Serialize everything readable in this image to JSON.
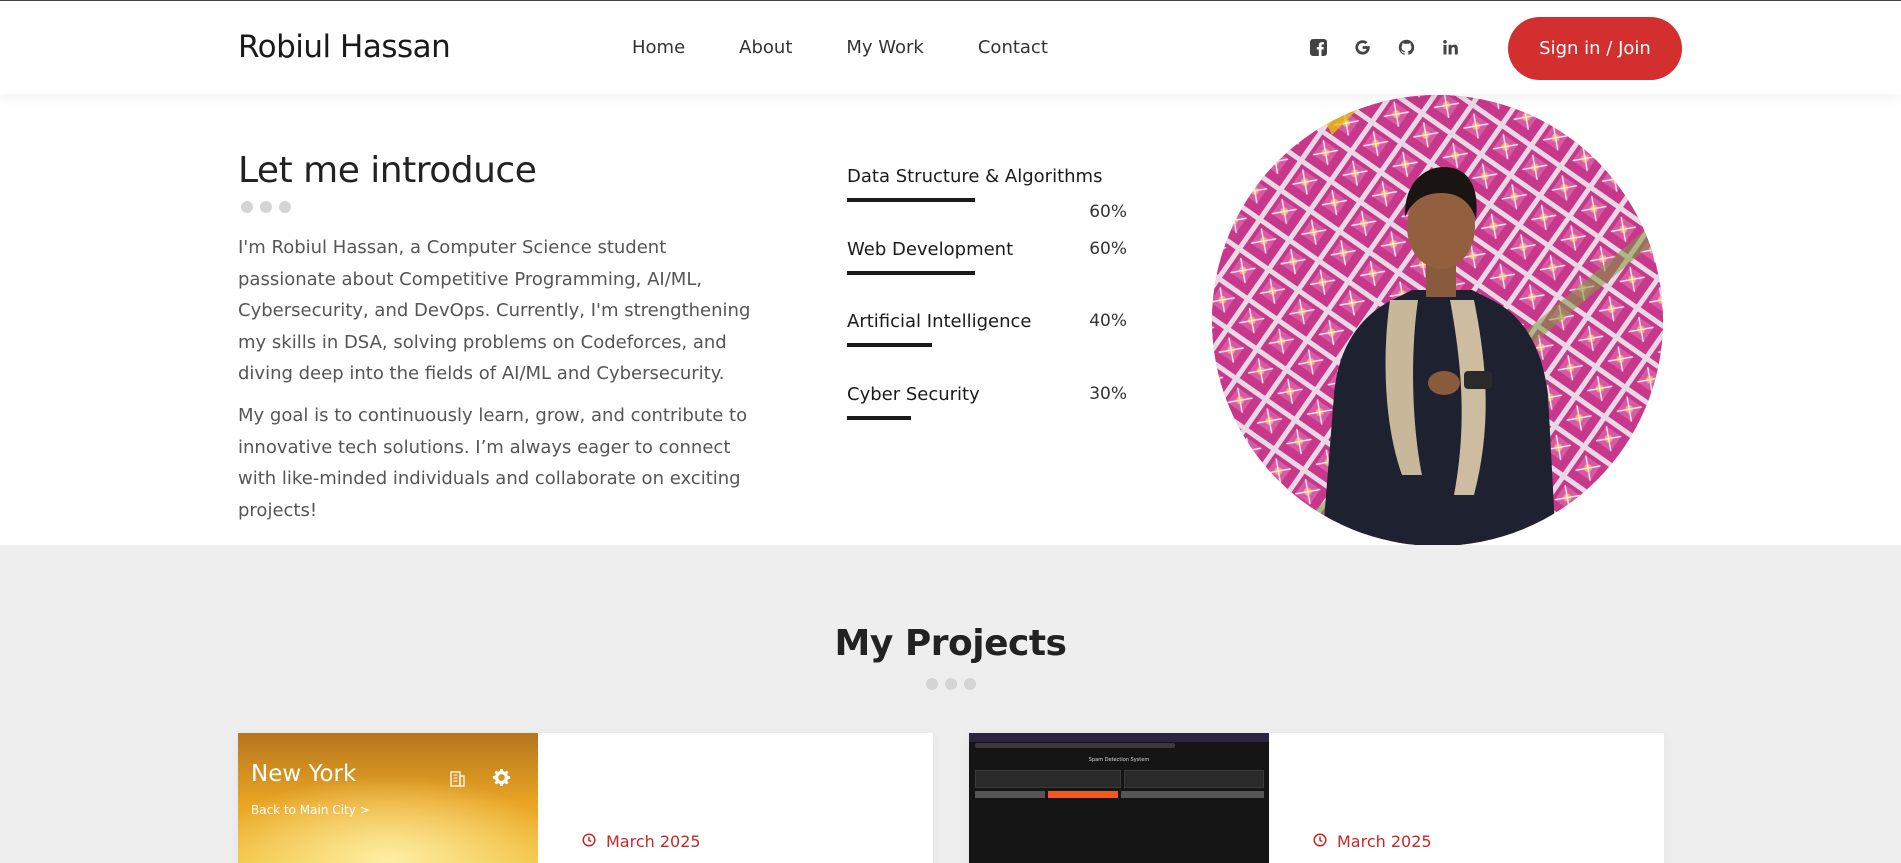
{
  "header": {
    "brand": "Robiul Hassan",
    "nav": [
      "Home",
      "About",
      "My Work",
      "Contact"
    ],
    "social_icons": [
      "facebook-icon",
      "google-icon",
      "github-icon",
      "linkedin-icon"
    ],
    "signin_label": "Sign in / Join"
  },
  "intro": {
    "title": "Let me introduce",
    "paragraphs": [
      "I'm Robiul Hassan, a Computer Science student passionate about Competitive Programming, AI/ML, Cybersecurity, and DevOps. Currently, I'm strengthening my skills in DSA, solving problems on Codeforces, and diving deep into the fields of AI/ML and Cybersecurity.",
      "My goal is to continuously learn, grow, and contribute to innovative tech solutions. I’m always eager to connect with like-minded individuals and collaborate on exciting projects!"
    ],
    "skills": [
      {
        "name": "Data Structure & Algorithms",
        "percent_label": "60%",
        "value": 60
      },
      {
        "name": "Web Development",
        "percent_label": "60%",
        "value": 60
      },
      {
        "name": "Artificial Intelligence",
        "percent_label": "40%",
        "value": 40
      },
      {
        "name": "Cyber Security",
        "percent_label": "30%",
        "value": 30
      }
    ]
  },
  "projects": {
    "title": "My Projects",
    "cards": [
      {
        "thumb_title": "New York",
        "thumb_link": "Back to Main City >",
        "date": "March 2025"
      },
      {
        "thumb_title": "Spam Detection System",
        "date": "March 2025"
      }
    ]
  },
  "colors": {
    "accent": "#d32f2f",
    "section_bg": "#eeeeee"
  }
}
